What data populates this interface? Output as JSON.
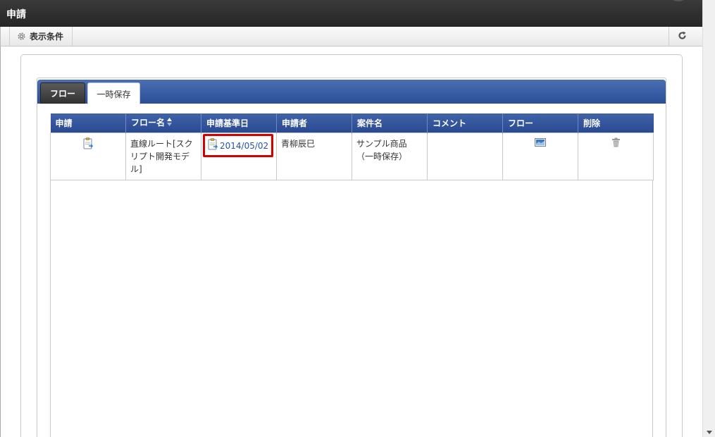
{
  "window": {
    "title": "申請"
  },
  "toolbar": {
    "conditions_label": "表示条件"
  },
  "tabs": [
    {
      "label": "フロー",
      "active": false
    },
    {
      "label": "一時保存",
      "active": true
    }
  ],
  "table": {
    "headers": [
      "申請",
      "フロー名",
      "申請基準日",
      "申請者",
      "案件名",
      "コメント",
      "フロー",
      "削除"
    ],
    "rows": [
      {
        "flow_name": "直線ルート[スクリプト開発モデル]",
        "date": "2014/05/02",
        "applicant": "青柳辰巳",
        "case_name": "サンプル商品（一時保存）",
        "comment": ""
      }
    ]
  },
  "icons": {
    "apply": "clipboard-icon",
    "date": "clipboard-icon",
    "flow": "flow-image-icon",
    "delete": "trash-icon",
    "refresh": "refresh-icon",
    "conditions": "gear-icon",
    "sort": "sort-icon"
  },
  "colors": {
    "header_bg": "#2f52a0",
    "highlight": "#d40000",
    "link": "#2454a8"
  }
}
